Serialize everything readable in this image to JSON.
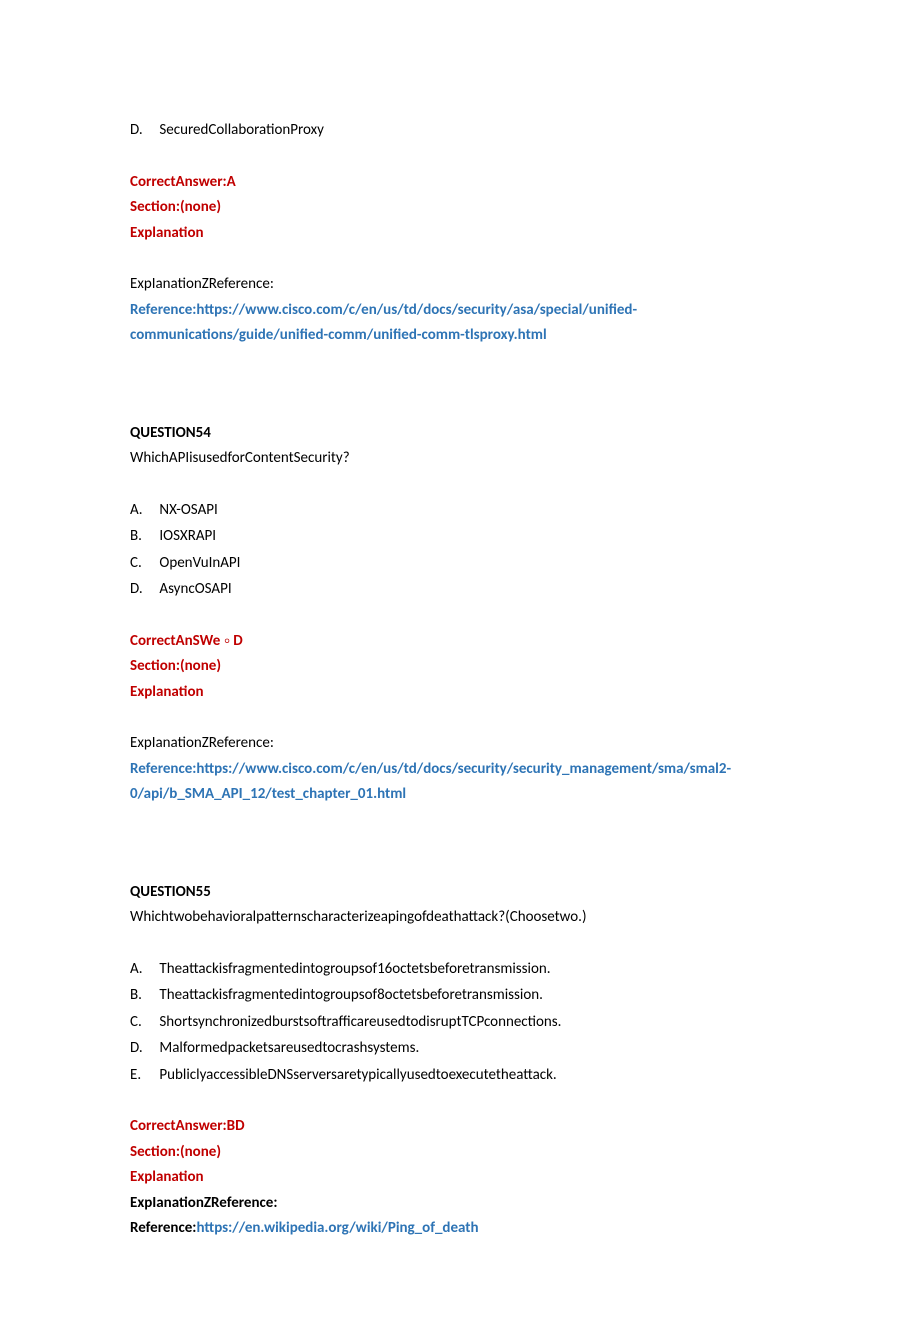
{
  "topAnswer": {
    "optionD": {
      "letter": "D.",
      "text": "SecuredCollaborationProxy"
    },
    "correctAnswer": "CorrectAnswer:A",
    "section": "Section:(none)",
    "explanation": "Explanation",
    "explRef": "ExpIanationZReference:",
    "reference": "Reference:https://www.cisco.com/c/en/us/td/docs/security/asa/special/unified-communications/guide/unified-comm/unified-comm-tlsproxy.html"
  },
  "q54": {
    "heading": "QUESTION54",
    "prompt": "WhichAPIisusedforContentSecurity?",
    "opts": [
      {
        "letter": "A.",
        "text": "NX-OSAPI"
      },
      {
        "letter": "B.",
        "text": "IOSXRAPI"
      },
      {
        "letter": "C.",
        "text": "OpenVuInAPI"
      },
      {
        "letter": "D.",
        "text": "AsyncOSAPI"
      }
    ],
    "correctPrefix": "CorrectAnSWe",
    "correctSuffix": "D",
    "correctGlyph": "⸰",
    "section": "Section:(none)",
    "explanation": "Explanation",
    "explRef": "ExpIanationZReference:",
    "reference": "Reference:https://www.cisco.com/c/en/us/td/docs/security/security_management/sma/smal2-0/api/b_SMA_API_12/test_chapter_01.html"
  },
  "q55": {
    "heading": "QUESTION55",
    "prompt": "Whichtwobehavioralpatternscharacterizeapingofdeathattack?(Choosetwo.)",
    "opts": [
      {
        "letter": "A.",
        "text": "Theattackisfragmentedintogroupsof16octetsbeforetransmission."
      },
      {
        "letter": "B.",
        "text": "Theattackisfragmentedintogroupsof8octetsbeforetransmission."
      },
      {
        "letter": "C.",
        "text": "ShortsynchronizedburstsoftrafficareusedtodisruptTCPconnections."
      },
      {
        "letter": "D.",
        "text": "Malformedpacketsareusedtocrashsystems."
      },
      {
        "letter": "E.",
        "text": "PubliclyaccessibleDNSserversaretypicallyusedtoexecutetheattack."
      }
    ],
    "correctAnswer": "CorrectAnswer:BD",
    "section": "Section:(none)",
    "explanation": "Explanation",
    "explRef": "ExpIanationZReference:",
    "refPrefix": "Reference:",
    "refLink": "https://en.wikipedia.org/wiki/Ping_of_death"
  }
}
